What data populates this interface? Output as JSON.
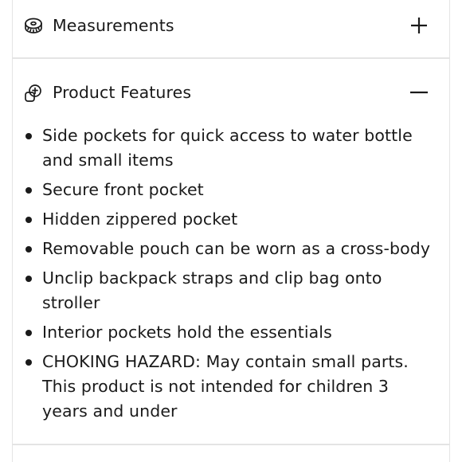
{
  "sections": {
    "measurements": {
      "title": "Measurements",
      "icon": "measuring-tape-icon",
      "expanded": false,
      "toggle_icon": "plus-icon"
    },
    "features": {
      "title": "Product Features",
      "icon": "product-features-icon",
      "expanded": true,
      "toggle_icon": "minus-icon",
      "items": [
        "Side pockets for quick access to water bottle and small items",
        "Secure front pocket",
        "Hidden zippered pocket",
        "Removable pouch can be worn as a cross-body",
        "Unclip backpack straps and clip bag onto stroller",
        "Interior pockets hold the essentials",
        "CHOKING HAZARD: May contain small parts. This product is not intended for children 3 years and under"
      ]
    }
  },
  "colors": {
    "text": "#1a1a1a",
    "divider": "#e4e4e4",
    "background": "#ffffff"
  }
}
